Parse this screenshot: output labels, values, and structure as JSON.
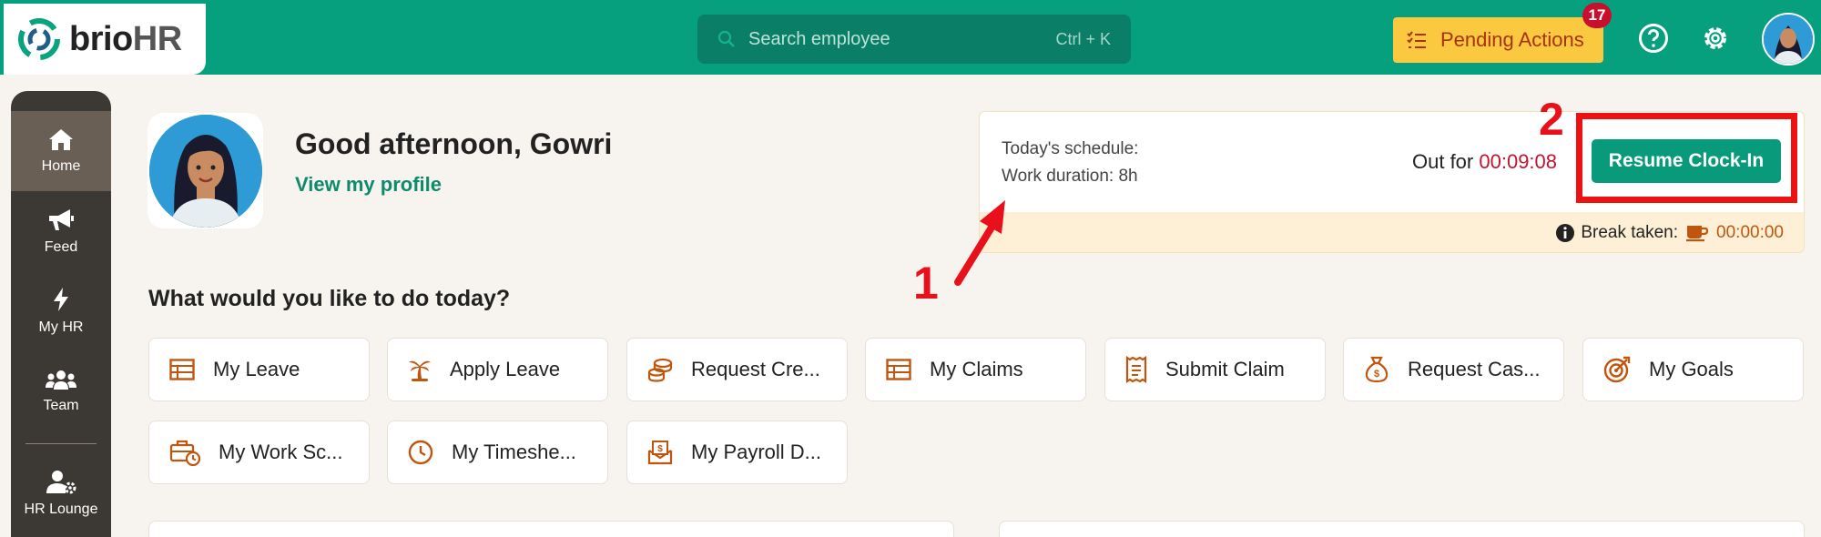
{
  "app": {
    "logo_brio": "brio",
    "logo_hr": "HR"
  },
  "search": {
    "placeholder": "Search employee",
    "shortcut": "Ctrl + K"
  },
  "header": {
    "pending_label": "Pending Actions",
    "pending_count": "17"
  },
  "sidebar": {
    "items": [
      {
        "label": "Home",
        "icon": "home-icon",
        "active": true
      },
      {
        "label": "Feed",
        "icon": "megaphone-icon"
      },
      {
        "label": "My HR",
        "icon": "bolt-icon"
      },
      {
        "label": "Team",
        "icon": "team-icon"
      },
      {
        "label": "HR Lounge",
        "icon": "user-gear-icon"
      }
    ]
  },
  "greeting": {
    "text": "Good afternoon, Gowri",
    "profile_link": "View my profile"
  },
  "schedule": {
    "line1": "Today's schedule:",
    "line2": "Work duration: 8h",
    "out_for_label": "Out for",
    "out_for_time": "00:09:08",
    "resume_label": "Resume Clock-In",
    "break_label": "Break taken:",
    "break_time": "00:00:00"
  },
  "actions": {
    "title": "What would you like to do today?",
    "tiles": [
      {
        "label": "My Leave",
        "icon": "table-icon"
      },
      {
        "label": "Apply Leave",
        "icon": "palm-tree-icon"
      },
      {
        "label": "Request Cre...",
        "icon": "coins-icon"
      },
      {
        "label": "My Claims",
        "icon": "table-icon"
      },
      {
        "label": "Submit Claim",
        "icon": "receipt-icon"
      },
      {
        "label": "Request Cas...",
        "icon": "money-bag-icon"
      },
      {
        "label": "My Goals",
        "icon": "target-icon"
      },
      {
        "label": "My Work Sc...",
        "icon": "briefcase-clock-icon"
      },
      {
        "label": "My Timeshe...",
        "icon": "clock-icon"
      },
      {
        "label": "My Payroll D...",
        "icon": "payslip-envelope-icon"
      }
    ]
  },
  "annotations": {
    "one": "1",
    "two": "2"
  },
  "colors": {
    "brand": "#07a07e",
    "accent_orange": "#c0560e",
    "alert_red": "#c0142f",
    "pending_bg": "#fbc93f"
  }
}
